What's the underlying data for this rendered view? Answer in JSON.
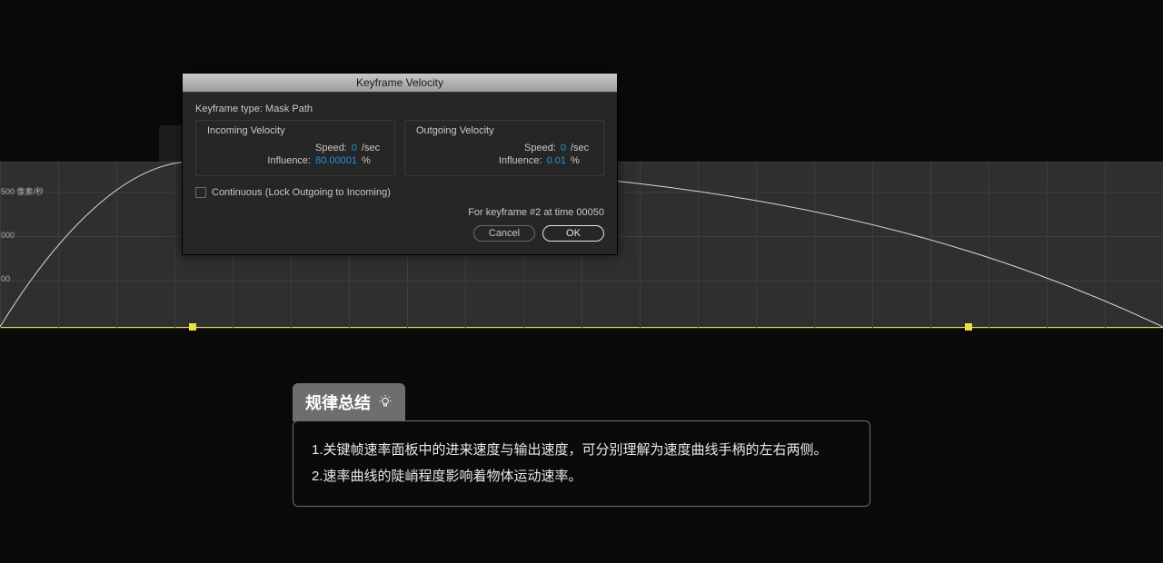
{
  "graph": {
    "axis500": "500 像素/秒",
    "axis000": "000",
    "axis00": "00"
  },
  "dialog": {
    "title": "Keyframe Velocity",
    "keyframe_type_label": "Keyframe type:",
    "keyframe_type_value": "Mask Path",
    "incoming": {
      "title": "Incoming Velocity",
      "speed_label": "Speed:",
      "speed_value": "0",
      "speed_unit": "/sec",
      "influence_label": "Influence:",
      "influence_value": "80.00001",
      "influence_unit": "%"
    },
    "outgoing": {
      "title": "Outgoing Velocity",
      "speed_label": "Speed:",
      "speed_value": "0",
      "speed_unit": "/sec",
      "influence_label": "Influence:",
      "influence_value": "0.01",
      "influence_unit": "%"
    },
    "continuous_label": "Continuous (Lock Outgoing to Incoming)",
    "continuous_checked": false,
    "info": "For keyframe #2 at time 00050",
    "cancel_label": "Cancel",
    "ok_label": "OK"
  },
  "summary": {
    "pill": "规律总结",
    "line1": "1.关键帧速率面板中的进来速度与输出速度，可分别理解为速度曲线手柄的左右两侧。",
    "line2": "2.速率曲线的陡峭程度影响着物体运动速率。"
  }
}
